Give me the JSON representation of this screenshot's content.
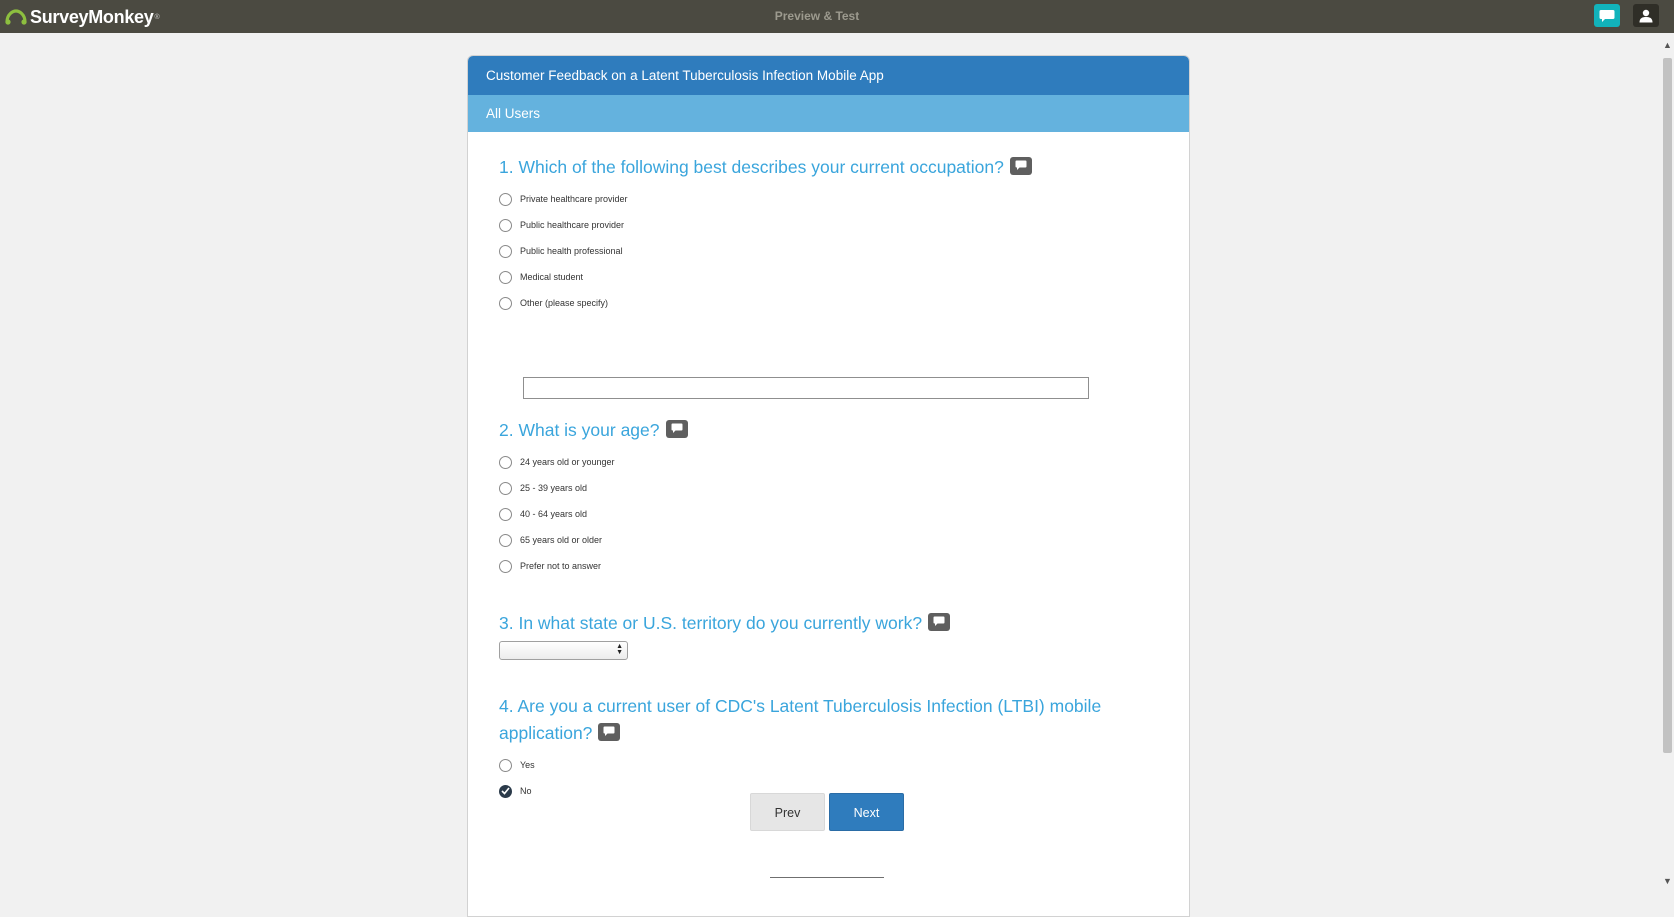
{
  "app": {
    "brand": "SurveyMonkey",
    "brand_mark": "®",
    "mode_title": "Preview & Test",
    "icons": {
      "chat": "chat-bubble-icon",
      "user": "user-icon"
    }
  },
  "survey": {
    "title": "Customer Feedback on a Latent Tuberculosis Infection Mobile App",
    "page_title": "All Users",
    "questions": [
      {
        "title": "1. Which of the following best describes your current occupation?",
        "options": [
          "Private healthcare provider",
          "Public healthcare provider",
          "Public health professional",
          "Medical student",
          "Other (please specify)"
        ],
        "other_value": ""
      },
      {
        "title": "2. What is your age?",
        "options": [
          "24 years old or younger",
          "25 - 39 years old",
          "40 - 64 years old",
          "65 years old or older",
          "Prefer not to answer"
        ]
      },
      {
        "title": "3. In what state or U.S. territory do you currently work?",
        "selected_value": ""
      },
      {
        "title": "4. Are you a current user of CDC's Latent Tuberculosis Infection (LTBI) mobile application?",
        "options": [
          "Yes",
          "No"
        ],
        "selected": "No"
      }
    ],
    "buttons": {
      "prev": "Prev",
      "next": "Next"
    }
  },
  "colors": {
    "topbar": "#4b4a41",
    "header": "#2f7cbd",
    "subheader": "#64b2de",
    "question_text": "#3aa5dc",
    "accent_chat": "#12b3bb"
  }
}
